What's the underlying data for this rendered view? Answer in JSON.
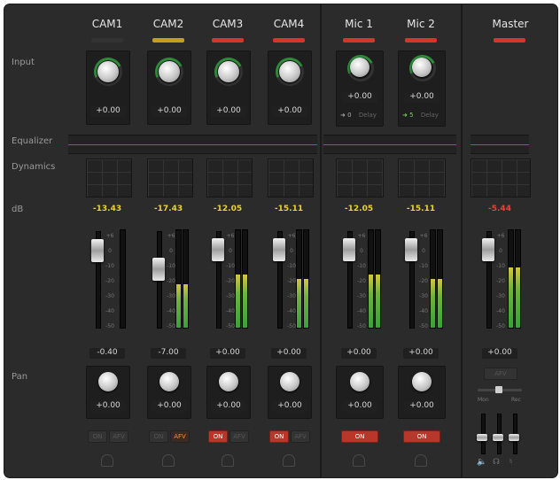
{
  "row_labels": {
    "input": "Input",
    "equalizer": "Equalizer",
    "dynamics": "Dynamics",
    "db": "dB",
    "pan": "Pan"
  },
  "channels": [
    {
      "name": "CAM1",
      "tally": "#333333",
      "input_gain": "+0.00",
      "db_peak": "-13.43",
      "fader_value": "-0.40",
      "pan": "+0.00",
      "btn1": "ON",
      "btn2": "AFV",
      "btn1_state": "off",
      "btn2_state": "off",
      "meter_level": 0.0
    },
    {
      "name": "CAM2",
      "tally": "#c89c1e",
      "input_gain": "+0.00",
      "db_peak": "-17.43",
      "fader_value": "-7.00",
      "pan": "+0.00",
      "btn1": "ON",
      "btn2": "AFV",
      "btn1_state": "off",
      "btn2_state": "afv",
      "meter_level": 0.45
    },
    {
      "name": "CAM3",
      "tally": "#d8342a",
      "input_gain": "+0.00",
      "db_peak": "-12.05",
      "fader_value": "+0.00",
      "pan": "+0.00",
      "btn1": "ON",
      "btn2": "AFV",
      "btn1_state": "on",
      "btn2_state": "off",
      "meter_level": 0.55
    },
    {
      "name": "CAM4",
      "tally": "#d8342a",
      "input_gain": "+0.00",
      "db_peak": "-15.11",
      "fader_value": "+0.00",
      "pan": "+0.00",
      "btn1": "ON",
      "btn2": "AFV",
      "btn1_state": "on",
      "btn2_state": "off",
      "meter_level": 0.5
    }
  ],
  "mics": [
    {
      "name": "Mic 1",
      "tally": "#d8342a",
      "input_gain": "+0.00",
      "delay": "0",
      "delay_label": "Delay",
      "db_peak": "-12.05",
      "fader_value": "+0.00",
      "pan": "+0.00",
      "btn1": "ON",
      "meter_level": 0.55
    },
    {
      "name": "Mic 2",
      "tally": "#d8342a",
      "input_gain": "+0.00",
      "delay": "5",
      "delay_label": "Delay",
      "db_peak": "-15.11",
      "fader_value": "+0.00",
      "pan": "+0.00",
      "btn1": "ON",
      "meter_level": 0.5
    }
  ],
  "master": {
    "name": "Master",
    "tally": "#d8342a",
    "db_peak": "-5.44",
    "fader_value": "+0.00",
    "afv_label": "AFV",
    "meter_level": 0.62,
    "monitor_labels": [
      "Mon",
      "Rec"
    ]
  },
  "scale_ticks": [
    "+6",
    "0",
    "-10",
    "-20",
    "-30",
    "-40",
    "-50"
  ],
  "colors": {
    "accent": "#2e8b3a",
    "tally_red": "#d8342a",
    "tally_yellow": "#c89c1e",
    "db_yellow": "#e7d23b",
    "db_red": "#e8423a"
  }
}
